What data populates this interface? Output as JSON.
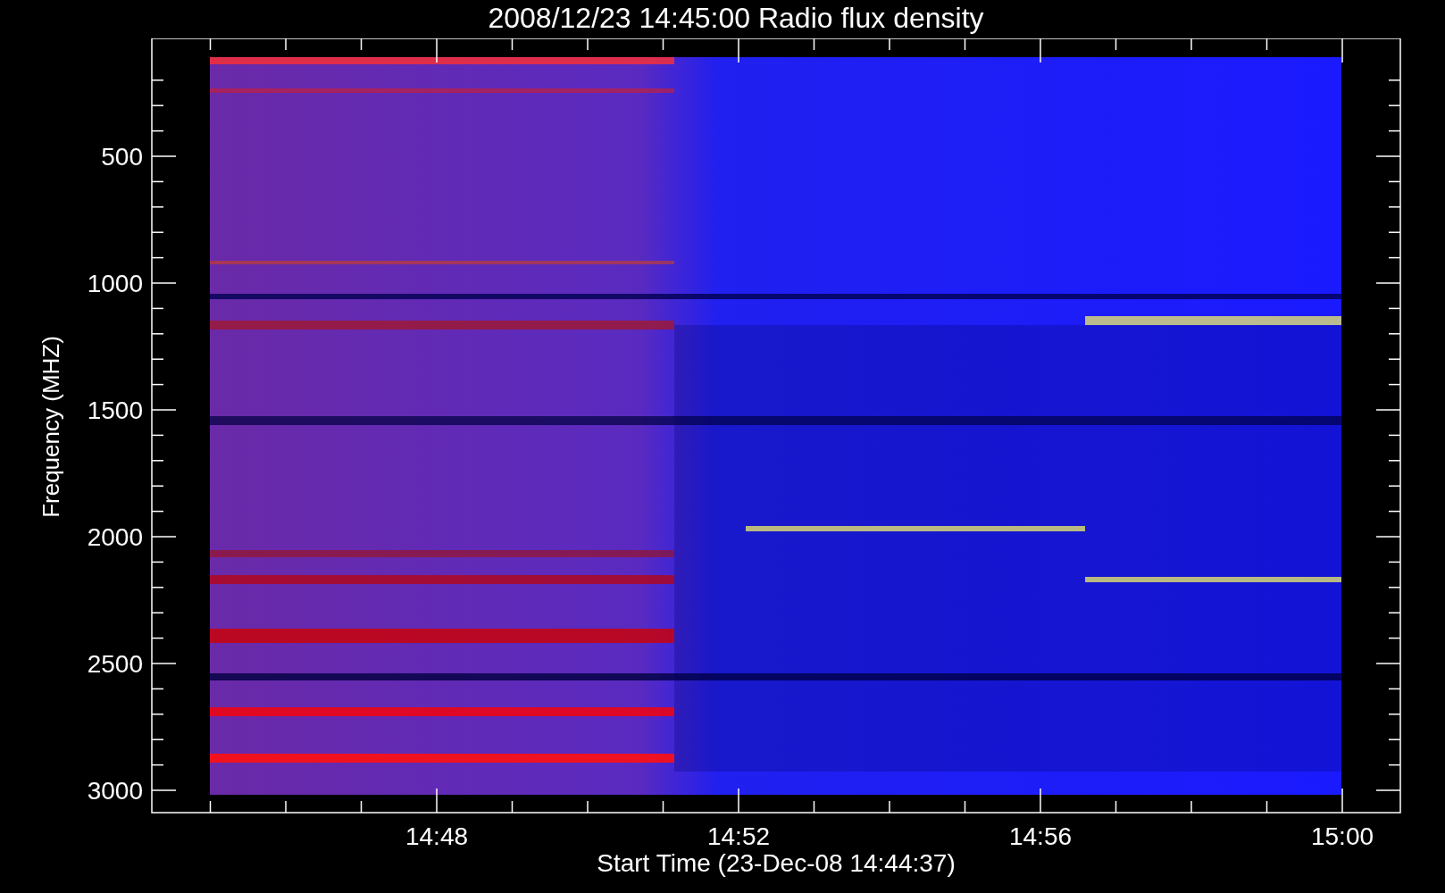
{
  "title": "2008/12/23 14:45:00 Radio flux density",
  "y_axis": {
    "label": "Frequency (MHZ)",
    "ticks": [
      "500",
      "1000",
      "1500",
      "2000",
      "2500",
      "3000"
    ]
  },
  "x_axis": {
    "label": "Start Time (23-Dec-08 14:44:37)",
    "ticks": [
      "14:48",
      "14:52",
      "14:56",
      "15:00"
    ]
  }
}
